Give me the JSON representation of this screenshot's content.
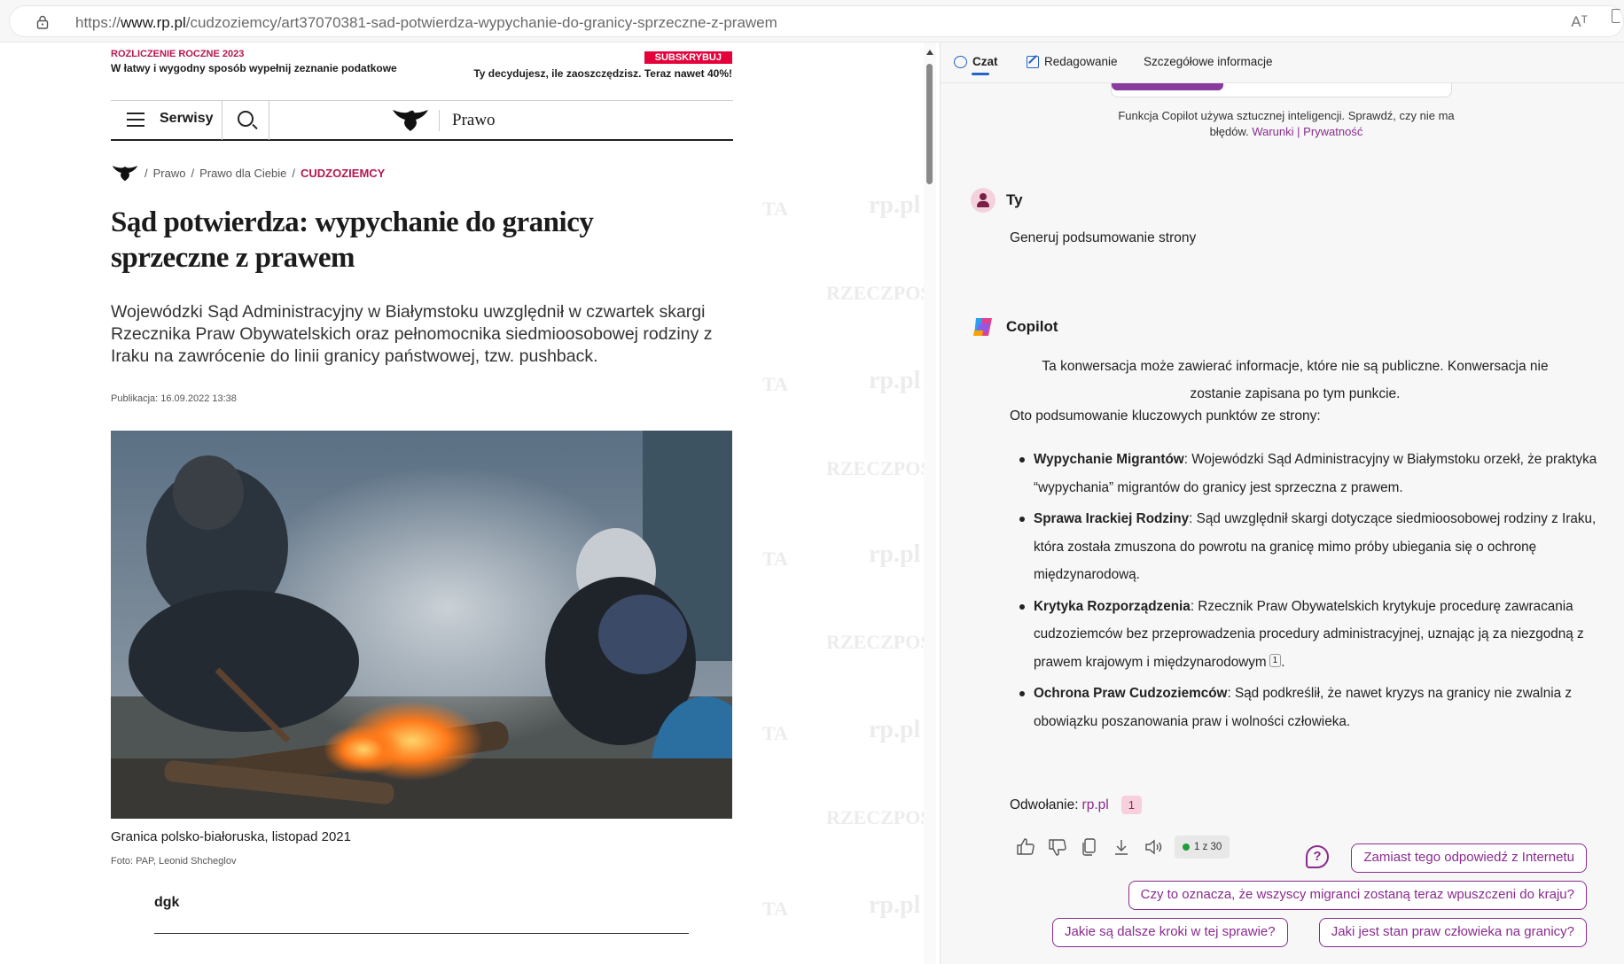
{
  "browser": {
    "url_prefix": "https://",
    "url_host": "www.rp.pl",
    "url_path": "/cudzoziemcy/art37070381-sad-potwierdza-wypychanie-do-granicy-sprzeczne-z-prawem",
    "read_aloud_label": "Aᵀ"
  },
  "article": {
    "watermark_rp": "rp.pl",
    "watermark_rz": "RZECZPOS",
    "watermark_ta": "TA",
    "promo": {
      "kicker": "ROZLICZENIE ROCZNE 2023",
      "text": "W łatwy i wygodny sposób wypełnij zeznanie podatkowe",
      "badge": "SUBSKRYBUJ",
      "right_text": "Ty decydujesz, ile zaoszczędzisz. Teraz nawet 40%!"
    },
    "nav": {
      "menu_label": "Serwisy",
      "section_label": "Prawo"
    },
    "breadcrumb": {
      "sep": "/",
      "items": [
        "Prawo",
        "Prawo dla Ciebie"
      ],
      "category": "CUDZOZIEMCY"
    },
    "headline": "Sąd potwierdza: wypychanie do granicy sprzeczne z prawem",
    "lead": "Wojewódzki Sąd Administracyjny w Białymstoku uwzględnił w czwartek skargi Rzecznika Praw Obywatelskich oraz pełnomocnika siedmioosobowej rodziny z Iraku na zawrócenie do linii granicy państwowej, tzw. pushback.",
    "pubdate": "Publikacja: 16.09.2022 13:38",
    "caption": "Granica polsko-białoruska, listopad 2021",
    "credit": "Foto: PAP, Leonid Shcheglov",
    "author": "dgk"
  },
  "copilot": {
    "tabs": [
      {
        "label": "Czat"
      },
      {
        "label": "Redagowanie"
      },
      {
        "label": "Szczegółowe informacje"
      }
    ],
    "disclaimer": "Funkcja Copilot używa sztucznej inteligencji. Sprawdź, czy nie ma błędów.",
    "terms_link": "Warunki",
    "link_sep": "|",
    "privacy_link": "Prywatność",
    "user_name": "Ty",
    "user_message": "Generuj podsumowanie strony",
    "bot_name": "Copilot",
    "notice": "Ta konwersacja może zawierać informacje, które nie są publiczne. Konwersacja nie zostanie zapisana po tym punkcie.",
    "intro": "Oto podsumowanie kluczowych punktów ze strony:",
    "bullets": [
      {
        "title": "Wypychanie Migrantów",
        "text": ": Wojewódzki Sąd Administracyjny w Białymstoku orzekł, że praktyka “wypychania” migrantów do granicy jest sprzeczna z prawem."
      },
      {
        "title": "Sprawa Irackiej Rodziny",
        "text": ": Sąd uwzględnił skargi dotyczące siedmioosobowej rodziny z Iraku, która została zmuszona do powrotu na granicę mimo próby ubiegania się o ochronę międzynarodową."
      },
      {
        "title": "Krytyka Rozporządzenia",
        "text": ": Rzecznik Praw Obywatelskich krytykuje procedurę zawracania cudzoziemców bez przeprowadzenia procedury administracyjnej, uznając ją za niezgodną z prawem krajowym i międzynarodowym",
        "cite": "1",
        "tail": "."
      },
      {
        "title": "Ochrona Praw Cudzoziemców",
        "text": ": Sąd podkreślił, że nawet kryzys na granicy nie zwalnia z obowiązku poszanowania praw i wolności człowieka."
      }
    ],
    "refs_label": "Odwołanie:",
    "refs_link": "rp.pl",
    "refs_badge": "1",
    "turn_counter": "1 z 30",
    "help_glyph": "?",
    "suggestions": [
      "Zamiast tego odpowiedź z Internetu",
      "Czy to oznacza, że wszyscy migranci zostaną teraz wpuszczeni do kraju?",
      "Jakie są dalsze kroki w tej sprawie?",
      "Jaki jest stan praw człowieka na granicy?"
    ],
    "accent_color": "#8a2b8f"
  }
}
